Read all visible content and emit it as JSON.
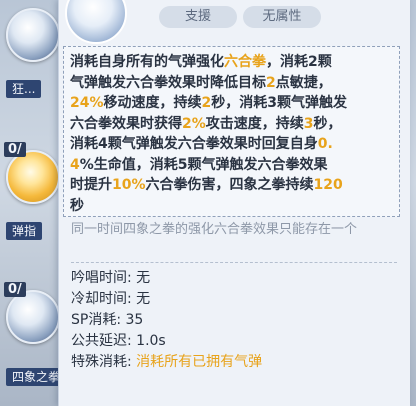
{
  "background_slots": [
    {
      "count": "",
      "label": "狂..."
    },
    {
      "count": "0/",
      "label": "弹指"
    },
    {
      "count": "0/",
      "label": "四象之拳"
    }
  ],
  "tooltip": {
    "tags": [
      "支援",
      "无属性"
    ],
    "description": [
      [
        {
          "t": "消耗自身所有的气弹强化"
        },
        {
          "t": "六合拳",
          "hl": true
        },
        {
          "t": "，消耗2颗"
        }
      ],
      [
        {
          "t": "气弹触发六合拳效果时降低目标"
        },
        {
          "t": "2",
          "hl": true
        },
        {
          "t": "点敏捷，"
        }
      ],
      [
        {
          "t": "24%",
          "hl": true
        },
        {
          "t": "移动速度，持续"
        },
        {
          "t": "2",
          "hl": true
        },
        {
          "t": "秒，消耗3颗气弹触发"
        }
      ],
      [
        {
          "t": "六合拳效果时获得"
        },
        {
          "t": "2%",
          "hl": true
        },
        {
          "t": "攻击速度，持续"
        },
        {
          "t": "3",
          "hl": true
        },
        {
          "t": "秒，"
        }
      ],
      [
        {
          "t": "消耗4颗气弹触发六合拳效果时回复自身"
        },
        {
          "t": "0.",
          "hl": true
        }
      ],
      [
        {
          "t": "4",
          "hl": true
        },
        {
          "t": "%生命值，消耗5颗气弹触发六合拳效果"
        }
      ],
      [
        {
          "t": "时提升"
        },
        {
          "t": "10%",
          "hl": true
        },
        {
          "t": "六合拳伤害，四象之拳持续"
        },
        {
          "t": "120",
          "hl": true
        }
      ],
      [
        {
          "t": "秒"
        }
      ]
    ],
    "note": "同一时间四象之拳的强化六合拳效果只能存在一个",
    "stats": [
      {
        "key": "吟唱时间:",
        "value": "无"
      },
      {
        "key": "冷却时间:",
        "value": "无"
      },
      {
        "key": "SP消耗:",
        "value": "35"
      },
      {
        "key": "公共延迟:",
        "value": "1.0s"
      },
      {
        "key": "特殊消耗:",
        "value": "消耗所有已拥有气弹",
        "orange": true
      }
    ],
    "colors": {
      "highlight": "#e8a31b",
      "text": "#2a3342",
      "note": "#8e98a8"
    }
  }
}
